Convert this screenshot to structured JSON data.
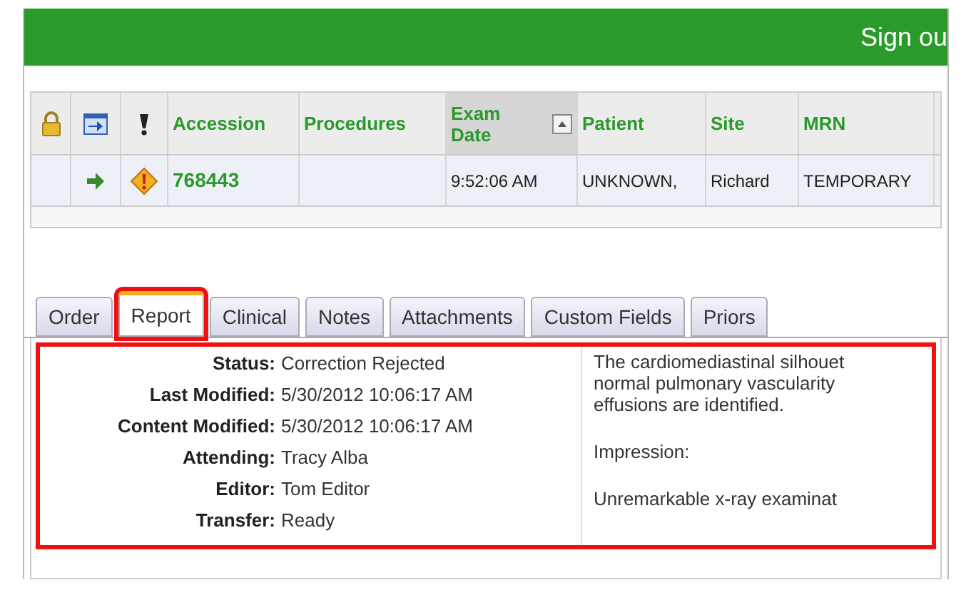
{
  "header": {
    "sign_out": "Sign ou"
  },
  "table": {
    "columns": [
      {
        "kind": "lock-icon"
      },
      {
        "kind": "link-icon"
      },
      {
        "kind": "priority-icon"
      },
      {
        "kind": "text",
        "label": "Accession"
      },
      {
        "kind": "text",
        "label": "Procedures"
      },
      {
        "kind": "sort",
        "label": "Exam Date"
      },
      {
        "kind": "text",
        "label": "Patient"
      },
      {
        "kind": "text",
        "label": "Site"
      },
      {
        "kind": "text",
        "label": "MRN"
      }
    ],
    "rows": [
      {
        "selected": false,
        "cells": [
          {
            "kind": "empty"
          },
          {
            "kind": "arrow"
          },
          {
            "kind": "alert"
          },
          {
            "kind": "text",
            "text": "768443"
          },
          {
            "kind": "empty"
          },
          {
            "kind": "text",
            "text": "9:52:06 AM"
          },
          {
            "kind": "text",
            "text": "UNKNOWN,"
          },
          {
            "kind": "text",
            "text": "Richard"
          },
          {
            "kind": "text",
            "text": "TEMPORARY"
          }
        ]
      }
    ]
  },
  "tabs": [
    {
      "label": "Order",
      "selected": false
    },
    {
      "label": "Report",
      "selected": true
    },
    {
      "label": "Clinical",
      "selected": false
    },
    {
      "label": "Notes",
      "selected": false
    },
    {
      "label": "Attachments",
      "selected": false
    },
    {
      "label": "Custom Fields",
      "selected": false
    },
    {
      "label": "Priors",
      "selected": false
    }
  ],
  "report": {
    "fields": [
      {
        "label": "Status:",
        "value": "Correction Rejected"
      },
      {
        "label": "Last Modified:",
        "value": "5/30/2012 10:06:17 AM"
      },
      {
        "label": "Content Modified:",
        "value": "5/30/2012 10:06:17 AM"
      },
      {
        "label": "Attending:",
        "value": "Tracy Alba"
      },
      {
        "label": "Editor:",
        "value": "Tom Editor"
      },
      {
        "label": "Transfer:",
        "value": "Ready"
      }
    ],
    "paragraphs": [
      {
        "lines": [
          "The cardiomediastinal silhouet",
          "normal pulmonary vascularity",
          "effusions are identified."
        ]
      },
      {
        "lines": [
          "Impression:"
        ]
      },
      {
        "lines": [
          "Unremarkable x-ray examinat"
        ]
      }
    ]
  }
}
